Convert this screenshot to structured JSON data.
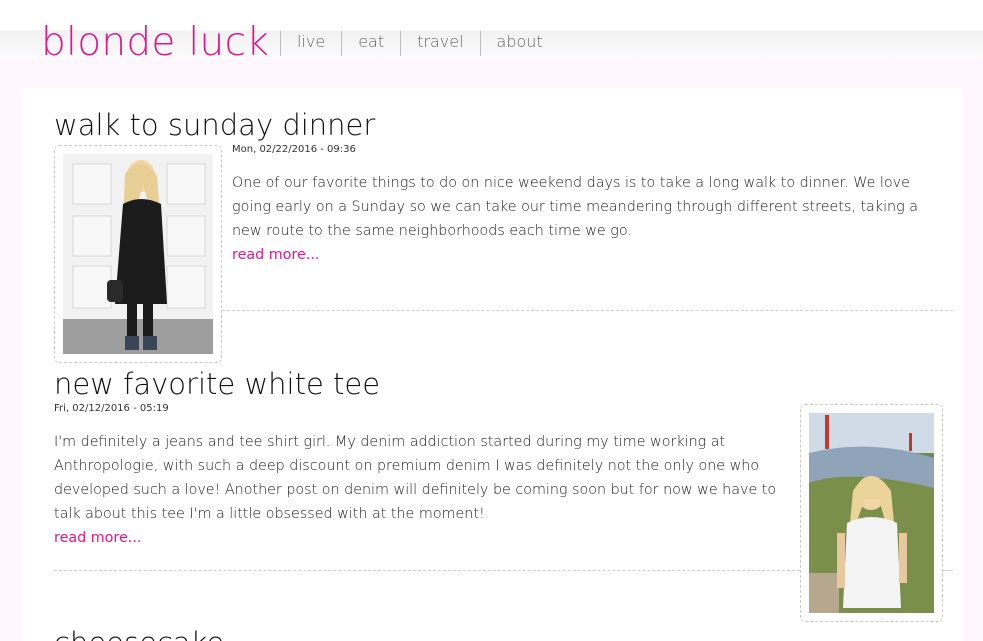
{
  "site": {
    "brand": "blonde luck"
  },
  "nav": {
    "items": [
      "live",
      "eat",
      "travel",
      "about"
    ]
  },
  "posts": [
    {
      "title": "walk to sunday dinner",
      "date": "Mon, 02/22/2016 - 09:36",
      "body": "One of our favorite things to do on nice weekend days is to take a long walk to dinner. We love going early on a Sunday so we can take our time meandering through different streets, taking a new route to the same neighborhoods each time we go.",
      "read_more": "read more..."
    },
    {
      "title": "new favorite white tee",
      "date": "Fri, 02/12/2016 - 05:19",
      "body": "I'm definitely a jeans and tee shirt girl. My denim addiction started during my time working at Anthropologie, with such a deep discount on premium denim I was definitely not the only one who developed such a love! Another post on denim will definitely be coming soon but for now we have to talk about this tee I'm a little obsessed with at the moment!",
      "read_more": "read more..."
    },
    {
      "title": "cheesecake",
      "date": "",
      "body": "",
      "read_more": ""
    }
  ],
  "colors": {
    "accent": "#e5148c",
    "page_bg": "#fff7fb"
  }
}
